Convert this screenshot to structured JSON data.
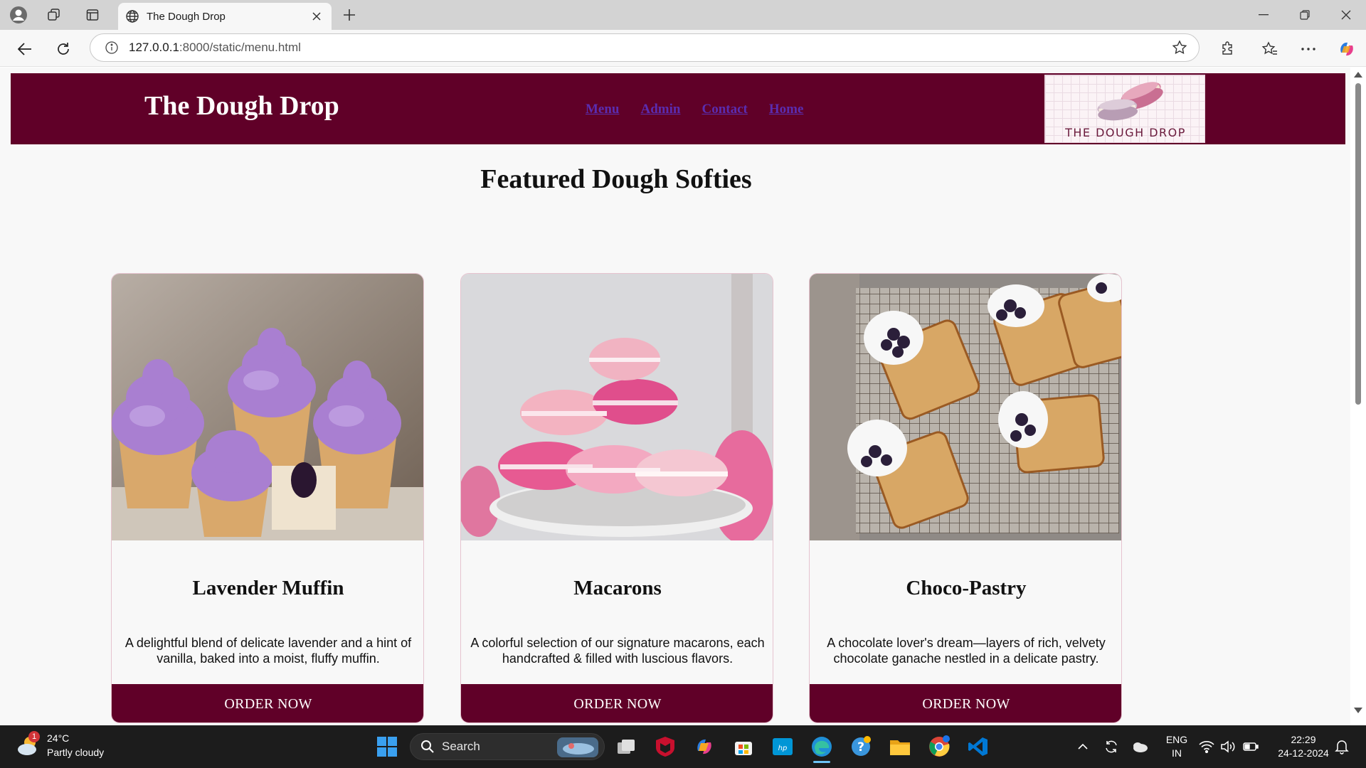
{
  "browser": {
    "tab_title": "The Dough Drop",
    "url_host": "127.0.0.1",
    "url_rest": ":8000/static/menu.html"
  },
  "site": {
    "brand": "The Dough Drop",
    "nav": [
      "Menu",
      "Admin",
      "Contact",
      "Home"
    ],
    "logo_text": "THE DOUGH DROP",
    "section_title": "Featured Dough Softies",
    "colors": {
      "primary": "#600028",
      "nav_link": "#5a2db0",
      "background": "#f8f8f8"
    }
  },
  "products": [
    {
      "name": "Lavender Muffin",
      "desc_line1": "A delightful blend of delicate lavender and a hint of",
      "desc_line2": "vanilla, baked into a moist, fluffy muffin.",
      "button": "ORDER NOW",
      "image_icon": "lavender-cupcakes-photo"
    },
    {
      "name": "Macarons",
      "desc_line1": "A colorful selection of our signature macarons, each",
      "desc_line2": "handcrafted & filled with luscious flavors.",
      "button": "ORDER NOW",
      "image_icon": "pink-macarons-photo"
    },
    {
      "name": "Choco-Pastry",
      "desc_line1": "A chocolate lover's dream—layers of rich, velvety",
      "desc_line2": "chocolate ganache nestled in a delicate pastry.",
      "button": "ORDER NOW",
      "image_icon": "pound-cakes-on-rack-photo"
    }
  ],
  "taskbar": {
    "temp": "24°C",
    "weather": "Partly cloudy",
    "weather_badge": "1",
    "search_placeholder": "Search",
    "lang_1": "ENG",
    "lang_2": "IN",
    "time": "22:29",
    "date": "24-12-2024"
  }
}
